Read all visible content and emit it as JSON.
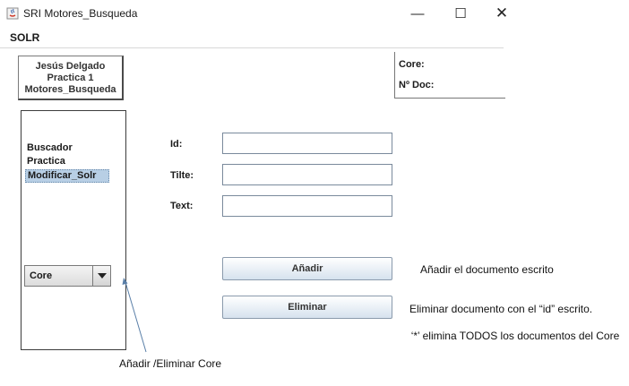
{
  "window": {
    "title": "SRI Motores_Busqueda",
    "minimize": "—",
    "maximize": "☐",
    "close": "✕"
  },
  "menu": {
    "solr": "SOLR"
  },
  "author": {
    "name": "Jesús Delgado",
    "practice": "Practica 1",
    "project": "Motores_Busqueda"
  },
  "core_info": {
    "core_label": "Core:",
    "ndoc_label": "Nº Doc:"
  },
  "nav": {
    "items": [
      "Buscador",
      "Practica",
      "Modificar_Solr"
    ],
    "selected": "Modificar_Solr"
  },
  "core_select": {
    "value": "Core"
  },
  "form": {
    "id_label": "Id:",
    "title_label": "Tilte:",
    "text_label": "Text:",
    "id_value": "",
    "title_value": "",
    "text_value": ""
  },
  "buttons": {
    "add": "Añadir",
    "delete": "Eliminar"
  },
  "annotations": {
    "add": "Añadir el documento escrito",
    "delete": "Eliminar documento con el “id” escrito.",
    "wildcard": "‘*’ elimina TODOS los documentos del Core",
    "core": "Añadir /Eliminar Core"
  },
  "colors": {
    "selection": "#b8cfe5",
    "button_gradient_end": "#d6e2ee",
    "arrow": "#5a7fa8"
  }
}
